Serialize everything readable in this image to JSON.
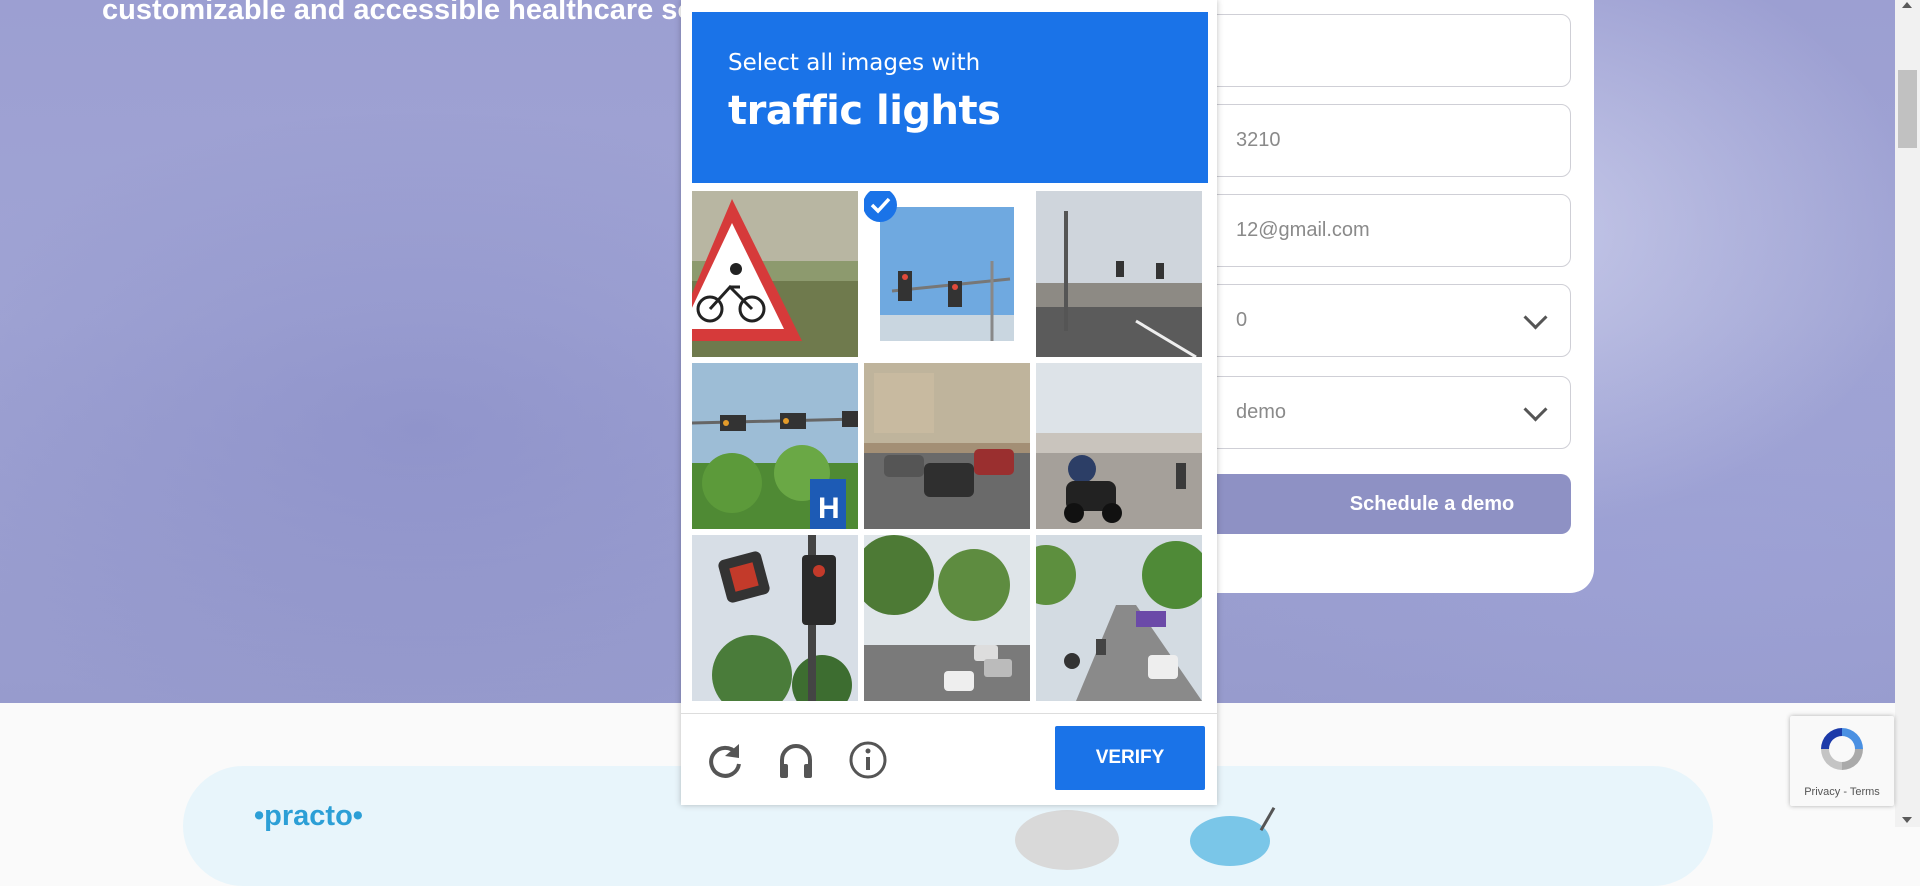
{
  "hero": {
    "tagline": "customizable and accessible healthcare solu"
  },
  "form": {
    "phone_value": "3210",
    "email_value": "12@gmail.com",
    "select1_value": "0",
    "select2_value": "demo",
    "submit_label": "Schedule a demo"
  },
  "captcha": {
    "instruction": "Select all images with",
    "target": "traffic lights",
    "tiles": [
      {
        "label": "bicycle warning sign",
        "selected": false
      },
      {
        "label": "traffic lights against sky",
        "selected": true
      },
      {
        "label": "street with overpass",
        "selected": false
      },
      {
        "label": "traffic lights and hospital sign",
        "selected": false
      },
      {
        "label": "street with parked cars",
        "selected": false
      },
      {
        "label": "motorcycle on street",
        "selected": false
      },
      {
        "label": "pedestrian signal",
        "selected": false
      },
      {
        "label": "tree lined road",
        "selected": false
      },
      {
        "label": "busy road with scooters",
        "selected": false
      }
    ],
    "controls": [
      "reload-icon",
      "audio-icon",
      "info-icon"
    ],
    "verify_label": "VERIFY",
    "colors": {
      "accent": "#1a73e8"
    }
  },
  "recaptcha_badge": {
    "text": "Privacy - Terms"
  },
  "footer": {
    "logo_text": "•practo•"
  }
}
